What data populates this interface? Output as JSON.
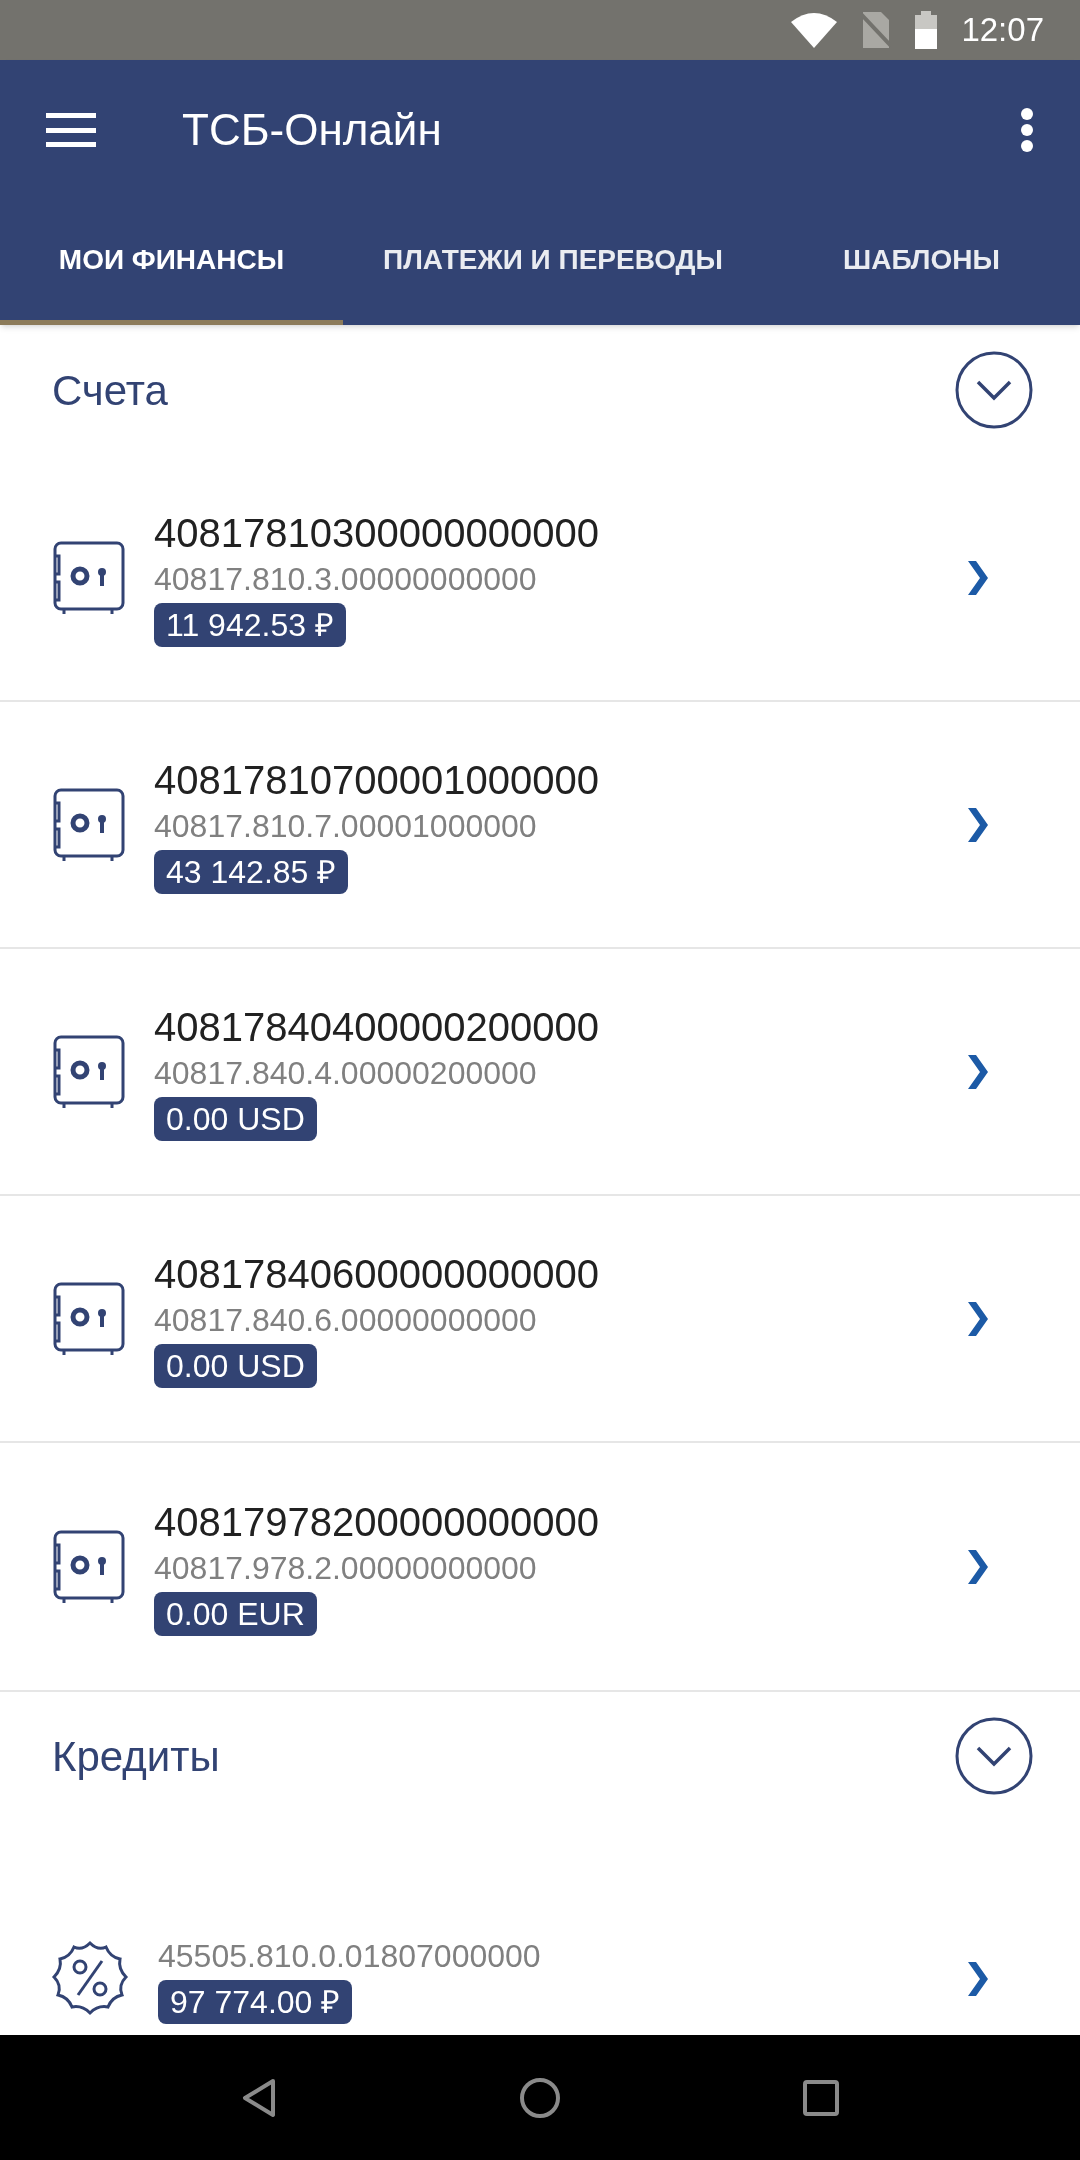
{
  "status_bar": {
    "time": "12:07"
  },
  "app_bar": {
    "title": "ТСБ-Онлайн"
  },
  "tabs": [
    {
      "label": "МОИ ФИНАНСЫ",
      "selected": true
    },
    {
      "label": "ПЛАТЕЖИ И ПЕРЕВОДЫ",
      "selected": false
    },
    {
      "label": "ШАБЛОНЫ",
      "selected": false
    }
  ],
  "sections": [
    {
      "title": "Счета",
      "items": [
        {
          "kind": "account",
          "number": "40817810300000000000",
          "formatted": "40817.810.3.00000000000",
          "balance": "11 942.53 ₽"
        },
        {
          "kind": "account",
          "number": "40817810700001000000",
          "formatted": "40817.810.7.00001000000",
          "balance": "43 142.85 ₽"
        },
        {
          "kind": "account",
          "number": "40817840400000200000",
          "formatted": "40817.840.4.00000200000",
          "balance": "0.00 USD"
        },
        {
          "kind": "account",
          "number": "40817840600000000000",
          "formatted": "40817.840.6.00000000000",
          "balance": "0.00 USD"
        },
        {
          "kind": "account",
          "number": "40817978200000000000",
          "formatted": "40817.978.2.00000000000",
          "balance": "0.00 EUR"
        }
      ]
    },
    {
      "title": "Кредиты",
      "items": [
        {
          "kind": "loan",
          "formatted": "45505.810.0.01807000000",
          "balance": "97 774.00 ₽"
        }
      ]
    }
  ]
}
